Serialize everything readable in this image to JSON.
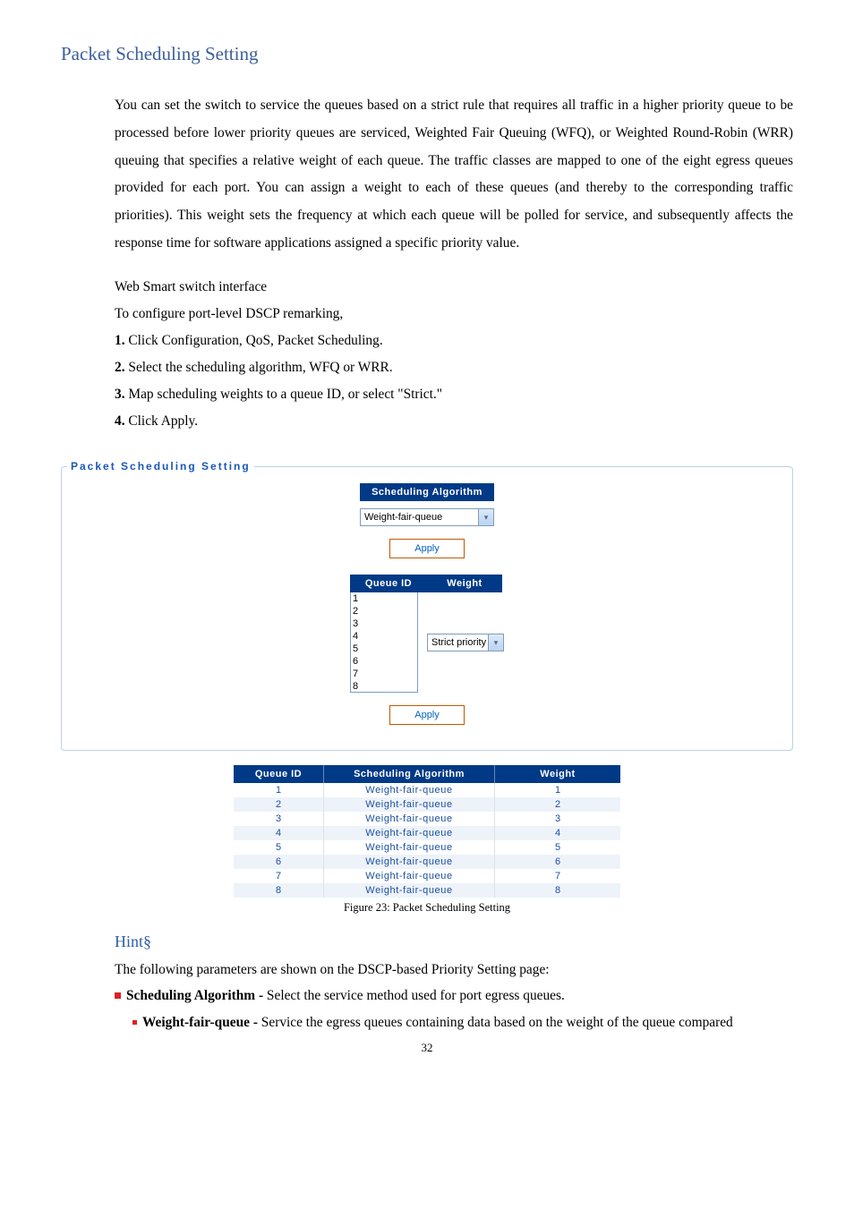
{
  "title": "Packet Scheduling Setting",
  "intro": "You can set the switch to service the queues based on a strict rule that requires all traffic in a higher priority queue to be processed before lower priority queues are serviced, Weighted Fair Queuing (WFQ), or Weighted Round-Robin (WRR) queuing that specifies a relative weight of each queue. The traffic classes are mapped to one of the eight egress queues provided for each port. You can assign a weight to each of these queues (and thereby to the corresponding traffic priorities). This weight sets the frequency at which each queue will be polled for service, and subsequently affects the response time for software applications assigned a specific priority value.",
  "iface_label": "Web Smart switch interface",
  "steps_intro": "To configure port-level DSCP remarking,",
  "steps": [
    {
      "n": "1.",
      "txt": " Click Configuration, QoS, Packet Scheduling."
    },
    {
      "n": "2.",
      "txt": " Select the scheduling algorithm, WFQ or WRR."
    },
    {
      "n": "3.",
      "txt": " Map scheduling weights to a queue ID, or select \"Strict.\""
    },
    {
      "n": "4.",
      "txt": " Click Apply."
    }
  ],
  "fieldset": {
    "legend": "Packet Scheduling Setting",
    "alg_header": "Scheduling Algorithm",
    "alg_value": "Weight-fair-queue",
    "apply": "Apply",
    "queue_id_header": "Queue ID",
    "weight_header": "Weight",
    "queue_options": [
      "1",
      "2",
      "3",
      "4",
      "5",
      "6",
      "7",
      "8"
    ],
    "weight_value": "Strict priority"
  },
  "table": {
    "headers": [
      "Queue ID",
      "Scheduling Algorithm",
      "Weight"
    ],
    "rows": [
      {
        "qid": "1",
        "alg": "Weight-fair-queue",
        "wt": "1"
      },
      {
        "qid": "2",
        "alg": "Weight-fair-queue",
        "wt": "2"
      },
      {
        "qid": "3",
        "alg": "Weight-fair-queue",
        "wt": "3"
      },
      {
        "qid": "4",
        "alg": "Weight-fair-queue",
        "wt": "4"
      },
      {
        "qid": "5",
        "alg": "Weight-fair-queue",
        "wt": "5"
      },
      {
        "qid": "6",
        "alg": "Weight-fair-queue",
        "wt": "6"
      },
      {
        "qid": "7",
        "alg": "Weight-fair-queue",
        "wt": "7"
      },
      {
        "qid": "8",
        "alg": "Weight-fair-queue",
        "wt": "8"
      }
    ]
  },
  "figure_caption": "Figure 23: Packet Scheduling Setting",
  "hint_title": "Hint§",
  "hint_intro": "The following parameters are shown on the DSCP-based Priority Setting page:",
  "hint_b1_label": "Scheduling Algorithm -",
  "hint_b1_txt": " Select the service method used for port egress queues.",
  "hint_b1a_label": "Weight-fair-queue -",
  "hint_b1a_txt": " Service the egress queues containing data based on the weight of the queue compared",
  "page_number": "32"
}
